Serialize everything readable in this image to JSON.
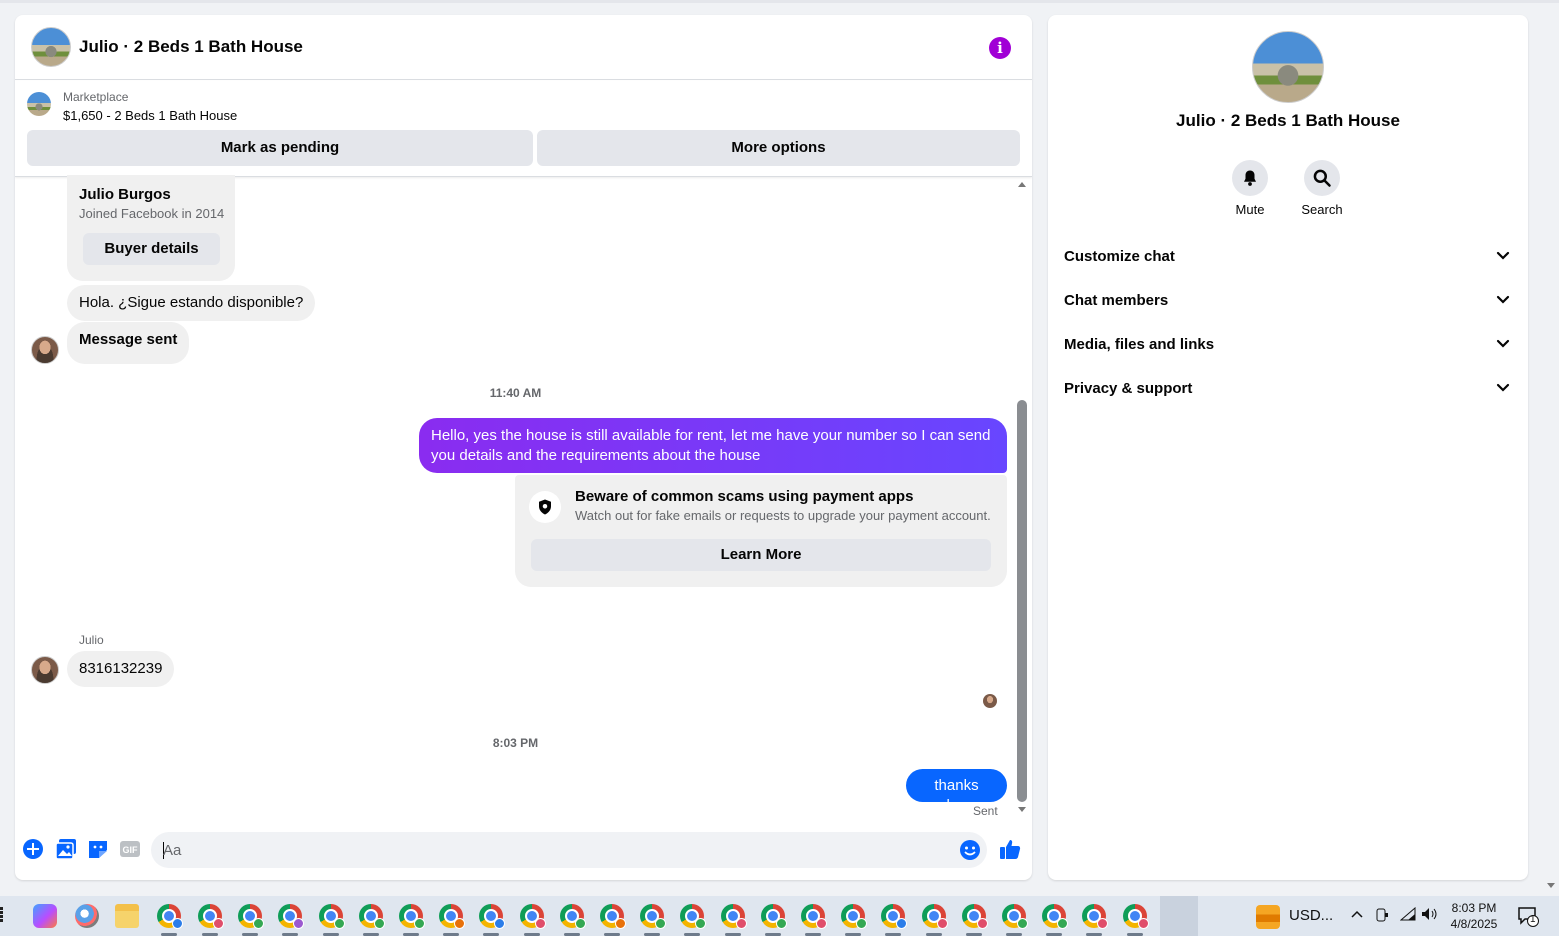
{
  "chat": {
    "title": "Julio · 2 Beds 1 Bath House",
    "marketplace_label": "Marketplace",
    "listing": "$1,650 - 2 Beds 1 Bath House",
    "mark_pending": "Mark as pending",
    "more_options": "More options",
    "buyer": {
      "name": "Julio Burgos",
      "joined": "Joined Facebook in 2014",
      "details_button": "Buyer details"
    },
    "messages": {
      "m1": "Hola. ¿Sigue estando disponible?",
      "m2": "Message sent",
      "ts1": "11:40 AM",
      "out1": "Hello, yes the house is still available for rent, let me have your number so I can send you details and the requirements about the house",
      "scam_title": "Beware of common scams using payment apps",
      "scam_desc": "Watch out for fake emails or requests to upgrade your payment account.",
      "learn_more": "Learn More",
      "sender": "Julio",
      "m3": "8316132239",
      "ts2": "8:03 PM",
      "out2": "thanks dear",
      "status": "Sent"
    },
    "composer": {
      "placeholder": "Aa"
    },
    "colors": {
      "outgoing_gradient": [
        "#8a2cf0",
        "#6846ff"
      ],
      "last_outgoing": "#0866ff",
      "accent": "#0866ff",
      "info": "#a100d6"
    }
  },
  "info_panel": {
    "title": "Julio · 2 Beds 1 Bath House",
    "actions": {
      "mute": "Mute",
      "search": "Search"
    },
    "sections": {
      "customize": "Customize chat",
      "members": "Chat members",
      "media": "Media, files and links",
      "privacy": "Privacy & support"
    }
  },
  "taskbar": {
    "ticker": "USD...",
    "time": "8:03 PM",
    "date": "4/8/2025",
    "notifications": "1",
    "icons": [
      "copilot-icon",
      "paint-icon",
      "file-explorer-icon",
      "chrome-icon"
    ]
  }
}
